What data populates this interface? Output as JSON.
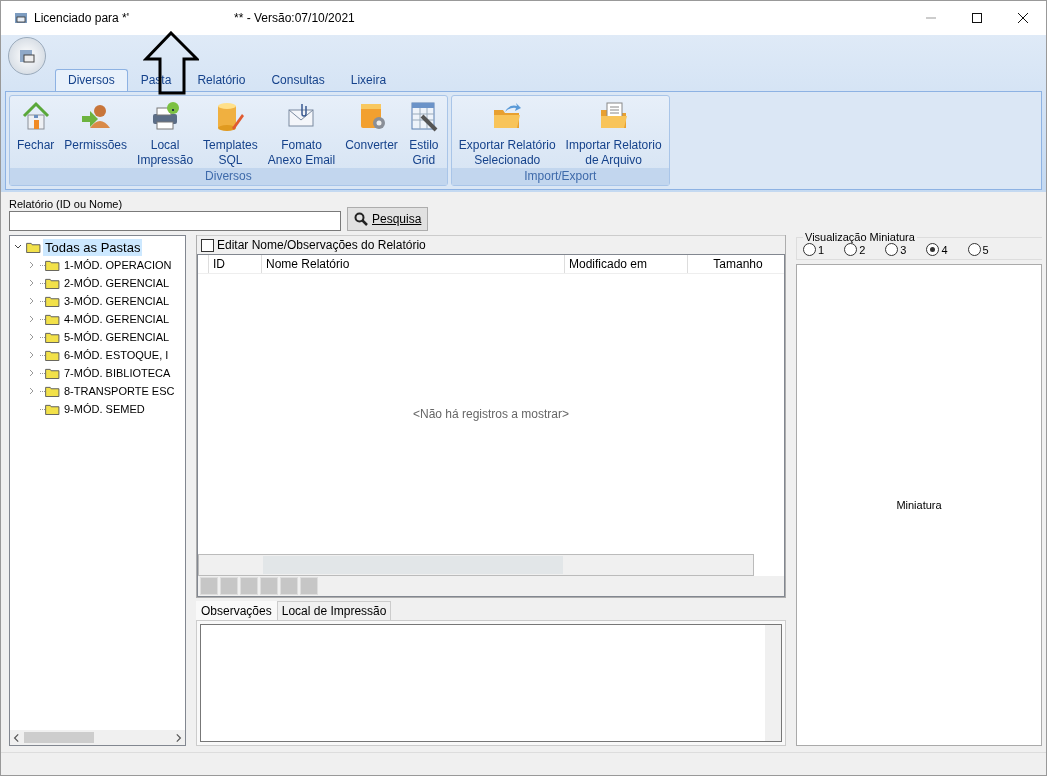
{
  "window": {
    "title_left": "Licenciado para *'",
    "title_right": "** - Versão:07/10/2021"
  },
  "ribbon": {
    "tabs": [
      {
        "label": "Diversos",
        "selected": true
      },
      {
        "label": "Pasta",
        "selected": false
      },
      {
        "label": "Relatório",
        "selected": false
      },
      {
        "label": "Consultas",
        "selected": false
      },
      {
        "label": "Lixeira",
        "selected": false
      }
    ],
    "groups": [
      {
        "label": "Diversos",
        "buttons": [
          {
            "kind": "home",
            "label": "Fechar"
          },
          {
            "kind": "user",
            "label": "Permissões"
          },
          {
            "kind": "printer",
            "label": "Local\nImpressão"
          },
          {
            "kind": "database",
            "label": "Templates\nSQL"
          },
          {
            "kind": "envelope",
            "label": "Fomato\nAnexo Email"
          },
          {
            "kind": "gear",
            "label": "Converter"
          },
          {
            "kind": "grid",
            "label": "Estilo\nGrid"
          }
        ]
      },
      {
        "label": "Import/Export",
        "buttons": [
          {
            "kind": "export",
            "label": "Exportar Relatório\nSelecionado"
          },
          {
            "kind": "import",
            "label": "Importar Relatorio\nde Arquivo"
          }
        ]
      }
    ]
  },
  "search": {
    "label": "Relatório (ID ou Nome)",
    "button": "Pesquisa"
  },
  "tree": {
    "label": "Todas as Pastas",
    "selected": true,
    "expanded": true,
    "children": [
      {
        "label": "1-MÓD. OPERACION",
        "expandable": true
      },
      {
        "label": "2-MÓD. GERENCIAL",
        "expandable": true
      },
      {
        "label": "3-MÓD. GERENCIAL",
        "expandable": true
      },
      {
        "label": "4-MÓD. GERENCIAL",
        "expandable": true
      },
      {
        "label": "5-MÓD. GERENCIAL",
        "expandable": true
      },
      {
        "label": "6-MÓD. ESTOQUE, I",
        "expandable": true
      },
      {
        "label": "7-MÓD. BIBLIOTECA",
        "expandable": true
      },
      {
        "label": "8-TRANSPORTE ESC",
        "expandable": true
      },
      {
        "label": "9-MÓD. SEMED",
        "expandable": false
      }
    ]
  },
  "grid": {
    "edit_checkbox": {
      "label": "Editar Nome/Observações do Relatório",
      "checked": false
    },
    "columns": [
      "ID",
      "Nome Relatório",
      "Modificado em",
      "Tamanho"
    ],
    "empty_message": "<Não há registros a mostrar>"
  },
  "bottom_tabs": [
    {
      "label": "Observações",
      "selected": true
    },
    {
      "label": "Local de Impressão",
      "selected": false
    }
  ],
  "preview": {
    "title": "Visualização Miniatura",
    "options": [
      {
        "label": "1",
        "selected": false
      },
      {
        "label": "2",
        "selected": false
      },
      {
        "label": "3",
        "selected": false
      },
      {
        "label": "4",
        "selected": true
      },
      {
        "label": "5",
        "selected": false
      }
    ],
    "placeholder": "Miniatura"
  }
}
